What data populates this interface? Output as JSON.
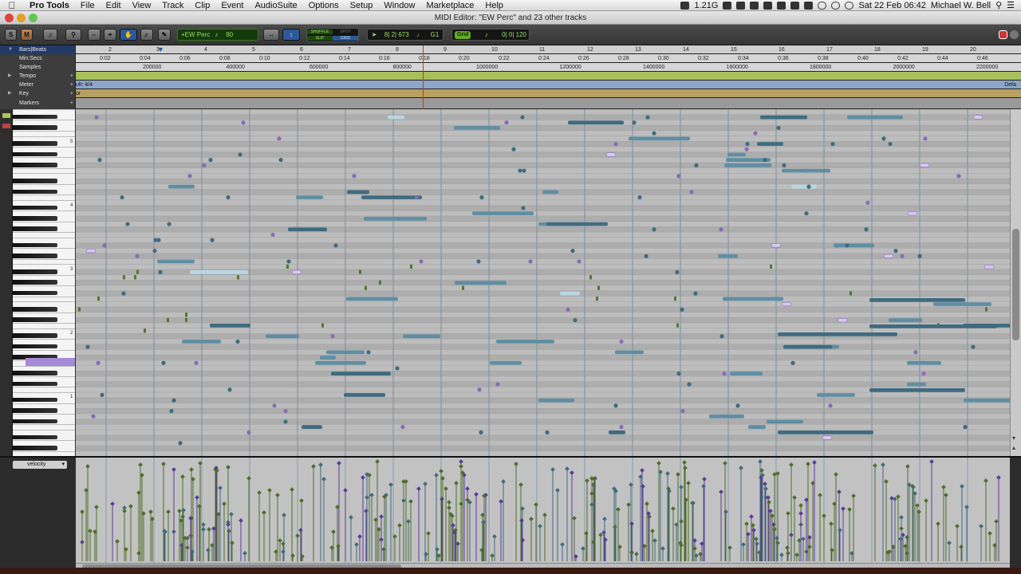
{
  "menubar": {
    "app": "Pro Tools",
    "menus": [
      "File",
      "Edit",
      "View",
      "Track",
      "Clip",
      "Event",
      "AudioSuite",
      "Options",
      "Setup",
      "Window",
      "Marketplace",
      "Help"
    ],
    "memory": "1.21G",
    "datetime": "Sat 22 Feb  06:42",
    "user": "Michael W. Bell"
  },
  "window": {
    "title": "MIDI Editor: \"EW Perc\" and 23 other tracks"
  },
  "toolbar": {
    "s_label": "S",
    "m_label": "M",
    "track_select": "+EW Perc",
    "velocity_value": "80",
    "edit_modes": {
      "shuffle": "SHUFFLE",
      "spot": "SPOT",
      "slip": "SLIP",
      "grid": "GRID"
    },
    "cursor_position": "8| 2| 673",
    "cursor_value": "G1",
    "grid_label": "Grid",
    "grid_value": "0| 0| 120"
  },
  "rulers": {
    "labels": [
      "Bars|Beats",
      "Min:Secs",
      "Samples",
      "Tempo",
      "Meter",
      "Key",
      "Markers"
    ],
    "bars": [
      "2",
      "3",
      "4",
      "5",
      "6",
      "7",
      "8",
      "9",
      "10",
      "11",
      "12",
      "13",
      "14",
      "15",
      "16",
      "17",
      "18",
      "19",
      "20"
    ],
    "minsecs": [
      "0:02",
      "0:04",
      "0:06",
      "0:08",
      "0:10",
      "0:12",
      "0:14",
      "0:16",
      "0:18",
      "0:20",
      "0:22",
      "0:24",
      "0:26",
      "0:28",
      "0:30",
      "0:32",
      "0:34",
      "0:36",
      "0:38",
      "0:40",
      "0:42",
      "0:44",
      "0:46"
    ],
    "samples": [
      "200000",
      "400000",
      "600000",
      "800000",
      "1000000",
      "1200000",
      "1400000",
      "1600000",
      "1800000",
      "2000000",
      "2200000"
    ],
    "meter_left": "ult: 4/4",
    "meter_right": "Defa",
    "key_left": "or"
  },
  "keyboard": {
    "octaves": [
      "5",
      "4",
      "3",
      "2",
      "1"
    ]
  },
  "velocity": {
    "label": "velocity"
  },
  "colors": {
    "note_blue": "#5f8ea3",
    "note_dark": "#3f6b80",
    "note_purple": "#8a6ab8",
    "note_green": "#4e7a2a",
    "note_light": "#b9d6e4",
    "tempo_bar": "#a7c05a",
    "meter_bar": "#8da6c8",
    "key_bar": "#b8a060",
    "playhead": "#d03030"
  }
}
